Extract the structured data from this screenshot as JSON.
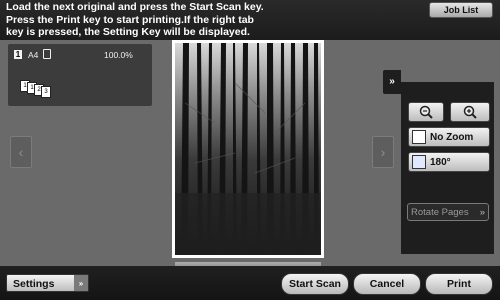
{
  "header": {
    "message_lines": [
      "Load the next original and press the Start Scan key.",
      "Press the Print key to start printing.If the right tab",
      "key is pressed, the Setting Key will be displayed."
    ],
    "job_list_label": "Job List"
  },
  "info_card": {
    "page_number": "1",
    "paper_size": "A4",
    "zoom_percent": "100.0%",
    "stack_pages": [
      "1",
      "1",
      "2",
      "3"
    ]
  },
  "preview": {
    "left_arrow": "‹",
    "right_arrow": "›"
  },
  "side_panel": {
    "tab_glyph": "»",
    "zoom_out_icon": "magnifier-minus-icon",
    "zoom_in_icon": "magnifier-plus-icon",
    "no_zoom_label": "No Zoom",
    "rotate_label": "180°",
    "rotate_pages_label": "Rotate Pages"
  },
  "footer": {
    "settings_label": "Settings",
    "start_scan_label": "Start Scan",
    "cancel_label": "Cancel",
    "print_label": "Print"
  }
}
